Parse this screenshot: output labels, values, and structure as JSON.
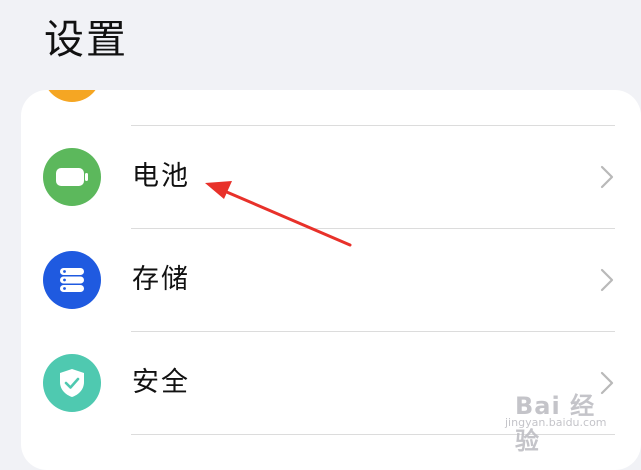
{
  "header": {
    "title": "设置"
  },
  "settings": {
    "items": [
      {
        "label": "电池",
        "icon": "battery-icon",
        "icon_color": "#5cb85c"
      },
      {
        "label": "存储",
        "icon": "storage-icon",
        "icon_color": "#1f5ae0"
      },
      {
        "label": "安全",
        "icon": "shield-check-icon",
        "icon_color": "#4fc9b0"
      }
    ],
    "partial_item_icon_color": "#f5a623"
  },
  "annotation": {
    "arrow_color": "#e8312a"
  },
  "watermark": {
    "main": "Bai 经验",
    "sub": "jingyan.baidu.com"
  }
}
